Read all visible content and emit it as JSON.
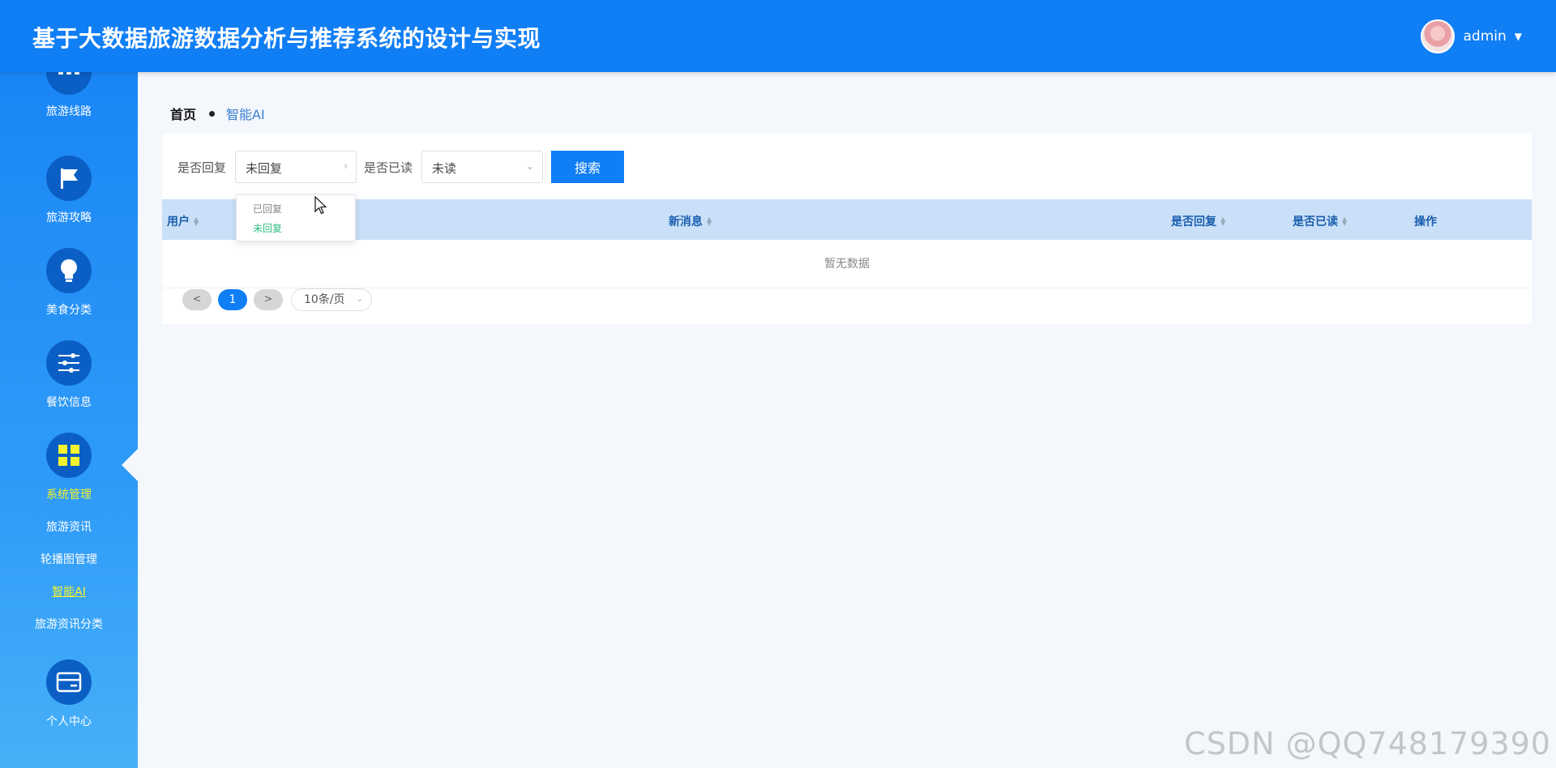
{
  "header": {
    "title": "基于大数据旅游数据分析与推荐系统的设计与实现",
    "user": "admin"
  },
  "sidebar": {
    "items": [
      {
        "label": "旅游线路",
        "icon": "dots-icon"
      },
      {
        "label": "旅游攻略",
        "icon": "flag-icon"
      },
      {
        "label": "美食分类",
        "icon": "lightbulb-icon"
      },
      {
        "label": "餐饮信息",
        "icon": "sliders-icon"
      },
      {
        "label": "系统管理",
        "icon": "grid-icon",
        "active": true
      },
      {
        "label": "个人中心",
        "icon": "card-icon"
      }
    ],
    "sub_items": [
      {
        "label": "旅游资讯"
      },
      {
        "label": "轮播图管理"
      },
      {
        "label": "智能AI",
        "active": true
      },
      {
        "label": "旅游资讯分类"
      }
    ],
    "active_color": "#f4f32f"
  },
  "breadcrumb": {
    "home": "首页",
    "current": "智能AI"
  },
  "filters": {
    "reply_label": "是否回复",
    "reply_value": "未回复",
    "read_label": "是否已读",
    "read_value": "未读",
    "search_button": "搜索"
  },
  "dropdown": {
    "options": [
      "已回复",
      "未回复"
    ]
  },
  "table": {
    "columns": [
      "用户",
      "新消息",
      "是否回复",
      "是否已读",
      "操作"
    ],
    "empty_text": "暂无数据"
  },
  "pager": {
    "prev": "<",
    "current": "1",
    "next": ">",
    "page_size": "10条/页"
  },
  "watermark": "CSDN @QQ748179390",
  "colors": {
    "primary": "#107ef5",
    "header_bg": "#107ef5",
    "table_head": "#c9e0f8"
  }
}
